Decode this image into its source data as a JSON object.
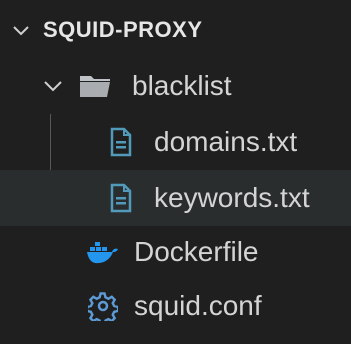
{
  "explorer": {
    "project_name": "SQUID-PROXY",
    "items": [
      {
        "label": "blacklist",
        "type": "folder",
        "icon": "folder-icon",
        "expanded": true
      },
      {
        "label": "domains.txt",
        "type": "file",
        "icon": "text-file-icon"
      },
      {
        "label": "keywords.txt",
        "type": "file",
        "icon": "text-file-icon",
        "hovered": true
      },
      {
        "label": "Dockerfile",
        "type": "file",
        "icon": "docker-icon"
      },
      {
        "label": "squid.conf",
        "type": "file",
        "icon": "gear-icon"
      }
    ]
  },
  "colors": {
    "background": "#1f1f1f",
    "hover_row": "#2a2d2e",
    "text": "#d4d4d4",
    "file_icon_blue": "#519aba",
    "docker_blue": "#2496ed",
    "gear_blue": "#5d9bd6"
  }
}
